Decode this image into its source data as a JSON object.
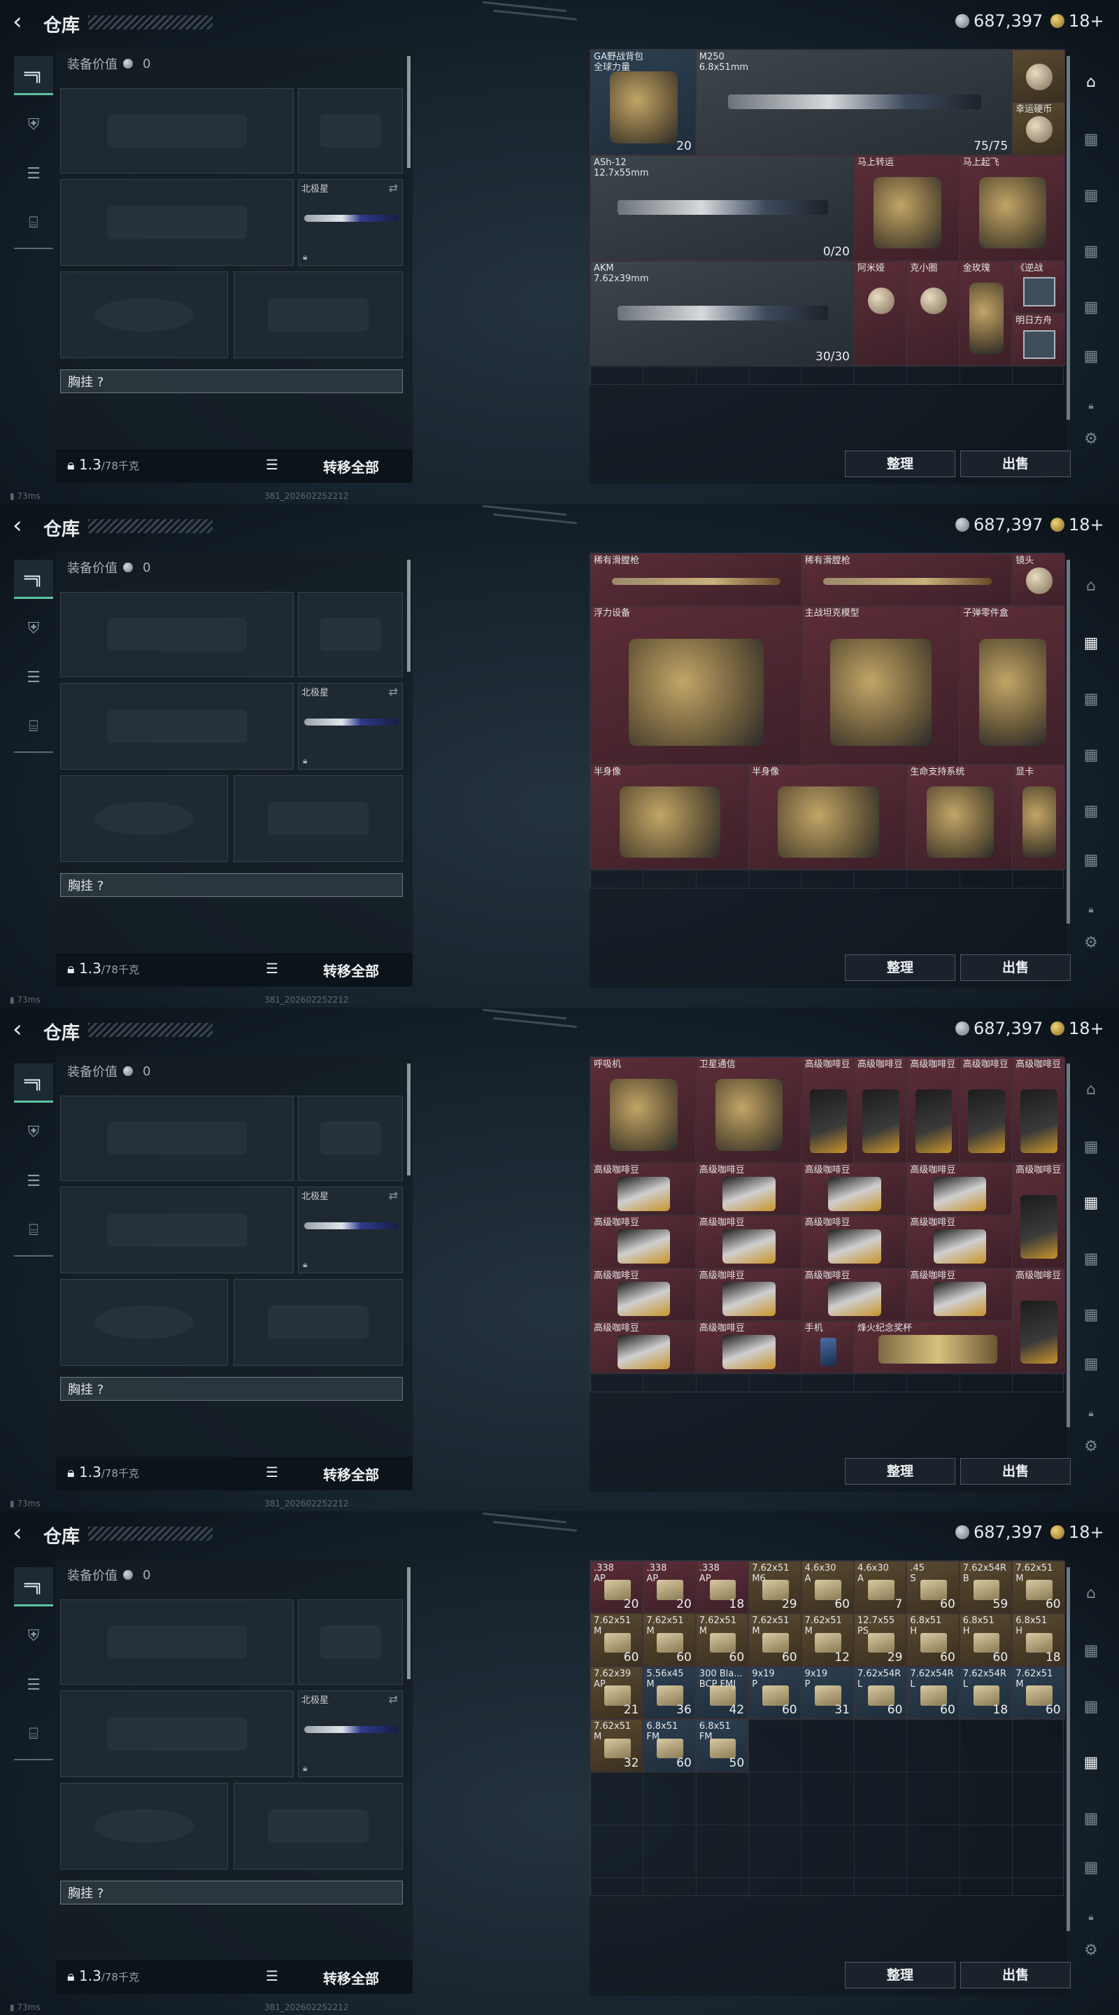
{
  "app": {
    "title": "仓库",
    "back_icon": "back-arrow-icon",
    "currency_silver": "687,397",
    "currency_gold": "18+",
    "ping": "73ms",
    "build": "381_202602252212"
  },
  "equip": {
    "label": "装备价值",
    "value": "0",
    "slot_northstar": "北极星",
    "chest_rig": "胸挂 ?",
    "weight": "1.3",
    "weight_max": "/78千克",
    "transfer_all": "转移全部"
  },
  "stash_actions": {
    "sort": "整理",
    "sell": "出售"
  },
  "screens": [
    {
      "items": [
        {
          "name": "GA野战背包\n全球力量",
          "count": "20",
          "cls": "blue",
          "c": 0,
          "r": 0,
          "w": 2,
          "h": 2,
          "art": "bag"
        },
        {
          "name": "M250\n6.8x51mm",
          "count": "75/75",
          "cls": "gray",
          "c": 2,
          "r": 0,
          "w": 6,
          "h": 2,
          "art": "gun"
        },
        {
          "name": "",
          "count": "",
          "cls": "gold",
          "c": 8,
          "r": 0,
          "w": 1,
          "h": 1,
          "art": "doll"
        },
        {
          "name": "幸运硬币",
          "count": "",
          "cls": "gold",
          "c": 8,
          "r": 1,
          "w": 1,
          "h": 1,
          "art": "coin"
        },
        {
          "name": "ASh-12\n12.7x55mm",
          "count": "0/20",
          "cls": "gray",
          "c": 0,
          "r": 2,
          "w": 5,
          "h": 2,
          "art": "gun"
        },
        {
          "name": "马上转运",
          "count": "",
          "cls": "red",
          "c": 5,
          "r": 2,
          "w": 2,
          "h": 2,
          "art": "wheel"
        },
        {
          "name": "马上起飞",
          "count": "",
          "cls": "red",
          "c": 7,
          "r": 2,
          "w": 2,
          "h": 2,
          "art": "horse"
        },
        {
          "name": "AKM\n7.62x39mm",
          "count": "30/30",
          "cls": "gray",
          "c": 0,
          "r": 4,
          "w": 5,
          "h": 2,
          "art": "gun"
        },
        {
          "name": "阿米娅",
          "count": "",
          "cls": "red",
          "c": 5,
          "r": 4,
          "w": 1,
          "h": 2,
          "art": "doll"
        },
        {
          "name": "克小圈",
          "count": "",
          "cls": "red",
          "c": 6,
          "r": 4,
          "w": 1,
          "h": 2,
          "art": "doll"
        },
        {
          "name": "金玫瑰",
          "count": "",
          "cls": "red",
          "c": 7,
          "r": 4,
          "w": 1,
          "h": 2,
          "art": "rose"
        },
        {
          "name": "《逆战",
          "count": "",
          "cls": "red",
          "c": 8,
          "r": 4,
          "w": 1,
          "h": 1,
          "art": "card"
        },
        {
          "name": "明日方舟",
          "count": "",
          "cls": "red",
          "c": 8,
          "r": 5,
          "w": 1,
          "h": 1,
          "art": "card"
        }
      ]
    },
    {
      "items": [
        {
          "name": "稀有滑膛枪",
          "count": "",
          "cls": "red",
          "c": 0,
          "r": 0,
          "w": 4,
          "h": 1,
          "art": "musket"
        },
        {
          "name": "稀有滑膛枪",
          "count": "",
          "cls": "red",
          "c": 4,
          "r": 0,
          "w": 4,
          "h": 1,
          "art": "musket"
        },
        {
          "name": "镜头",
          "count": "",
          "cls": "red",
          "c": 8,
          "r": 0,
          "w": 1,
          "h": 1,
          "art": "lens"
        },
        {
          "name": "浮力设备",
          "count": "",
          "cls": "red",
          "c": 0,
          "r": 1,
          "w": 4,
          "h": 3,
          "art": "device"
        },
        {
          "name": "主战坦克模型",
          "count": "",
          "cls": "red",
          "c": 4,
          "r": 1,
          "w": 3,
          "h": 3,
          "art": "tank"
        },
        {
          "name": "子弹零件盒",
          "count": "",
          "cls": "red",
          "c": 7,
          "r": 1,
          "w": 2,
          "h": 3,
          "art": "box"
        },
        {
          "name": "半身像",
          "count": "",
          "cls": "red",
          "c": 0,
          "r": 4,
          "w": 3,
          "h": 2,
          "art": "bust"
        },
        {
          "name": "半身像",
          "count": "",
          "cls": "red",
          "c": 3,
          "r": 4,
          "w": 3,
          "h": 2,
          "art": "bust"
        },
        {
          "name": "生命支持系统",
          "count": "",
          "cls": "red",
          "c": 6,
          "r": 4,
          "w": 2,
          "h": 2,
          "art": "machine"
        },
        {
          "name": "显卡",
          "count": "",
          "cls": "red",
          "c": 8,
          "r": 4,
          "w": 1,
          "h": 2,
          "art": "gpu"
        }
      ]
    },
    {
      "items": [
        {
          "name": "呼吸机",
          "count": "",
          "cls": "red",
          "c": 0,
          "r": 0,
          "w": 2,
          "h": 2,
          "art": "radio"
        },
        {
          "name": "卫星通信",
          "count": "",
          "cls": "red",
          "c": 2,
          "r": 0,
          "w": 2,
          "h": 2,
          "art": "dish"
        },
        {
          "name": "高级咖啡豆",
          "count": "",
          "cls": "red",
          "c": 4,
          "r": 0,
          "w": 1,
          "h": 2,
          "art": "bag2"
        },
        {
          "name": "高级咖啡豆",
          "count": "",
          "cls": "red",
          "c": 5,
          "r": 0,
          "w": 1,
          "h": 2,
          "art": "bag2"
        },
        {
          "name": "高级咖啡豆",
          "count": "",
          "cls": "red",
          "c": 6,
          "r": 0,
          "w": 1,
          "h": 2,
          "art": "bag2"
        },
        {
          "name": "高级咖啡豆",
          "count": "",
          "cls": "red",
          "c": 7,
          "r": 0,
          "w": 1,
          "h": 2,
          "art": "bag2"
        },
        {
          "name": "高级咖啡豆",
          "count": "",
          "cls": "red",
          "c": 8,
          "r": 0,
          "w": 1,
          "h": 2,
          "art": "bag2"
        },
        {
          "name": "高级咖啡豆",
          "count": "",
          "cls": "red",
          "c": 0,
          "r": 2,
          "w": 2,
          "h": 1,
          "art": "bag3"
        },
        {
          "name": "高级咖啡豆",
          "count": "",
          "cls": "red",
          "c": 2,
          "r": 2,
          "w": 2,
          "h": 1,
          "art": "bag3"
        },
        {
          "name": "高级咖啡豆",
          "count": "",
          "cls": "red",
          "c": 4,
          "r": 2,
          "w": 2,
          "h": 1,
          "art": "bag3"
        },
        {
          "name": "高级咖啡豆",
          "count": "",
          "cls": "red",
          "c": 6,
          "r": 2,
          "w": 2,
          "h": 1,
          "art": "bag3"
        },
        {
          "name": "高级咖啡豆",
          "count": "",
          "cls": "red",
          "c": 8,
          "r": 2,
          "w": 1,
          "h": 2,
          "art": "bag2"
        },
        {
          "name": "高级咖啡豆",
          "count": "",
          "cls": "red",
          "c": 0,
          "r": 3,
          "w": 2,
          "h": 1,
          "art": "bag3"
        },
        {
          "name": "高级咖啡豆",
          "count": "",
          "cls": "red",
          "c": 2,
          "r": 3,
          "w": 2,
          "h": 1,
          "art": "bag3"
        },
        {
          "name": "高级咖啡豆",
          "count": "",
          "cls": "red",
          "c": 4,
          "r": 3,
          "w": 2,
          "h": 1,
          "art": "bag3"
        },
        {
          "name": "高级咖啡豆",
          "count": "",
          "cls": "red",
          "c": 6,
          "r": 3,
          "w": 2,
          "h": 1,
          "art": "bag3"
        },
        {
          "name": "高级咖啡豆",
          "count": "",
          "cls": "red",
          "c": 0,
          "r": 4,
          "w": 2,
          "h": 1,
          "art": "bag3"
        },
        {
          "name": "高级咖啡豆",
          "count": "",
          "cls": "red",
          "c": 2,
          "r": 4,
          "w": 2,
          "h": 1,
          "art": "bag3"
        },
        {
          "name": "高级咖啡豆",
          "count": "",
          "cls": "red",
          "c": 4,
          "r": 4,
          "w": 2,
          "h": 1,
          "art": "bag3"
        },
        {
          "name": "高级咖啡豆",
          "count": "",
          "cls": "red",
          "c": 6,
          "r": 4,
          "w": 2,
          "h": 1,
          "art": "bag3"
        },
        {
          "name": "高级咖啡豆",
          "count": "",
          "cls": "red",
          "c": 8,
          "r": 4,
          "w": 1,
          "h": 2,
          "art": "bag2"
        },
        {
          "name": "高级咖啡豆",
          "count": "",
          "cls": "red",
          "c": 0,
          "r": 5,
          "w": 2,
          "h": 1,
          "art": "bag3"
        },
        {
          "name": "高级咖啡豆",
          "count": "",
          "cls": "red",
          "c": 2,
          "r": 5,
          "w": 2,
          "h": 1,
          "art": "bag3"
        },
        {
          "name": "手机",
          "count": "",
          "cls": "red",
          "c": 4,
          "r": 5,
          "w": 1,
          "h": 1,
          "art": "phone"
        },
        {
          "name": "烽火纪念奖杯",
          "count": "",
          "cls": "red",
          "c": 5,
          "r": 5,
          "w": 3,
          "h": 1,
          "art": "trophy"
        }
      ]
    },
    {
      "items": [
        {
          "name": ".338\nAP",
          "count": "20",
          "cls": "red",
          "c": 0,
          "r": 0,
          "w": 1,
          "h": 1,
          "art": "ammo"
        },
        {
          "name": ".338\nAP",
          "count": "20",
          "cls": "red",
          "c": 1,
          "r": 0,
          "w": 1,
          "h": 1,
          "art": "ammo"
        },
        {
          "name": ".338\nAP",
          "count": "18",
          "cls": "red",
          "c": 2,
          "r": 0,
          "w": 1,
          "h": 1,
          "art": "ammo"
        },
        {
          "name": "7.62x51\nM6",
          "count": "29",
          "cls": "gold",
          "c": 3,
          "r": 0,
          "w": 1,
          "h": 1,
          "art": "ammo"
        },
        {
          "name": "4.6x30\nA",
          "count": "60",
          "cls": "gold",
          "c": 4,
          "r": 0,
          "w": 1,
          "h": 1,
          "art": "ammo"
        },
        {
          "name": "4.6x30\nA",
          "count": "7",
          "cls": "gold",
          "c": 5,
          "r": 0,
          "w": 1,
          "h": 1,
          "art": "ammo"
        },
        {
          "name": ".45\nS",
          "count": "60",
          "cls": "gold",
          "c": 6,
          "r": 0,
          "w": 1,
          "h": 1,
          "art": "ammo"
        },
        {
          "name": "7.62x54R\nB",
          "count": "59",
          "cls": "gold",
          "c": 7,
          "r": 0,
          "w": 1,
          "h": 1,
          "art": "ammo"
        },
        {
          "name": "7.62x51\nM",
          "count": "60",
          "cls": "gold",
          "c": 8,
          "r": 0,
          "w": 1,
          "h": 1,
          "art": "ammo"
        },
        {
          "name": "7.62x51\nM",
          "count": "60",
          "cls": "gold",
          "c": 0,
          "r": 1,
          "w": 1,
          "h": 1,
          "art": "ammo"
        },
        {
          "name": "7.62x51\nM",
          "count": "60",
          "cls": "gold",
          "c": 1,
          "r": 1,
          "w": 1,
          "h": 1,
          "art": "ammo"
        },
        {
          "name": "7.62x51\nM",
          "count": "60",
          "cls": "gold",
          "c": 2,
          "r": 1,
          "w": 1,
          "h": 1,
          "art": "ammo"
        },
        {
          "name": "7.62x51\nM",
          "count": "60",
          "cls": "gold",
          "c": 3,
          "r": 1,
          "w": 1,
          "h": 1,
          "art": "ammo"
        },
        {
          "name": "7.62x51\nM",
          "count": "12",
          "cls": "gold",
          "c": 4,
          "r": 1,
          "w": 1,
          "h": 1,
          "art": "ammo"
        },
        {
          "name": "12.7x55\nPS",
          "count": "29",
          "cls": "gold",
          "c": 5,
          "r": 1,
          "w": 1,
          "h": 1,
          "art": "ammo"
        },
        {
          "name": "6.8x51\nH",
          "count": "60",
          "cls": "gold",
          "c": 6,
          "r": 1,
          "w": 1,
          "h": 1,
          "art": "ammo"
        },
        {
          "name": "6.8x51\nH",
          "count": "60",
          "cls": "gold",
          "c": 7,
          "r": 1,
          "w": 1,
          "h": 1,
          "art": "ammo"
        },
        {
          "name": "6.8x51\nH",
          "count": "18",
          "cls": "gold",
          "c": 8,
          "r": 1,
          "w": 1,
          "h": 1,
          "art": "ammo"
        },
        {
          "name": "7.62x39\nAP",
          "count": "21",
          "cls": "gold",
          "c": 0,
          "r": 2,
          "w": 1,
          "h": 1,
          "art": "ammo"
        },
        {
          "name": "5.56x45\nM",
          "count": "36",
          "cls": "blue",
          "c": 1,
          "r": 2,
          "w": 1,
          "h": 1,
          "art": "ammo"
        },
        {
          "name": "300 Bla...\nBCP FMJ",
          "count": "42",
          "cls": "blue",
          "c": 2,
          "r": 2,
          "w": 1,
          "h": 1,
          "art": "ammo"
        },
        {
          "name": "9x19\nP",
          "count": "60",
          "cls": "blue",
          "c": 3,
          "r": 2,
          "w": 1,
          "h": 1,
          "art": "ammo"
        },
        {
          "name": "9x19\nP",
          "count": "31",
          "cls": "blue",
          "c": 4,
          "r": 2,
          "w": 1,
          "h": 1,
          "art": "ammo"
        },
        {
          "name": "7.62x54R\nL",
          "count": "60",
          "cls": "blue",
          "c": 5,
          "r": 2,
          "w": 1,
          "h": 1,
          "art": "ammo"
        },
        {
          "name": "7.62x54R\nL",
          "count": "60",
          "cls": "blue",
          "c": 6,
          "r": 2,
          "w": 1,
          "h": 1,
          "art": "ammo"
        },
        {
          "name": "7.62x54R\nL",
          "count": "18",
          "cls": "blue",
          "c": 7,
          "r": 2,
          "w": 1,
          "h": 1,
          "art": "ammo"
        },
        {
          "name": "7.62x51\nM",
          "count": "60",
          "cls": "blue",
          "c": 8,
          "r": 2,
          "w": 1,
          "h": 1,
          "art": "ammo"
        },
        {
          "name": "7.62x51\nM",
          "count": "32",
          "cls": "gold",
          "c": 0,
          "r": 3,
          "w": 1,
          "h": 1,
          "art": "ammo"
        },
        {
          "name": "6.8x51\nFM",
          "count": "60",
          "cls": "blue",
          "c": 1,
          "r": 3,
          "w": 1,
          "h": 1,
          "art": "ammo"
        },
        {
          "name": "6.8x51\nFM",
          "count": "50",
          "cls": "blue",
          "c": 2,
          "r": 3,
          "w": 1,
          "h": 1,
          "art": "ammo"
        }
      ]
    }
  ]
}
